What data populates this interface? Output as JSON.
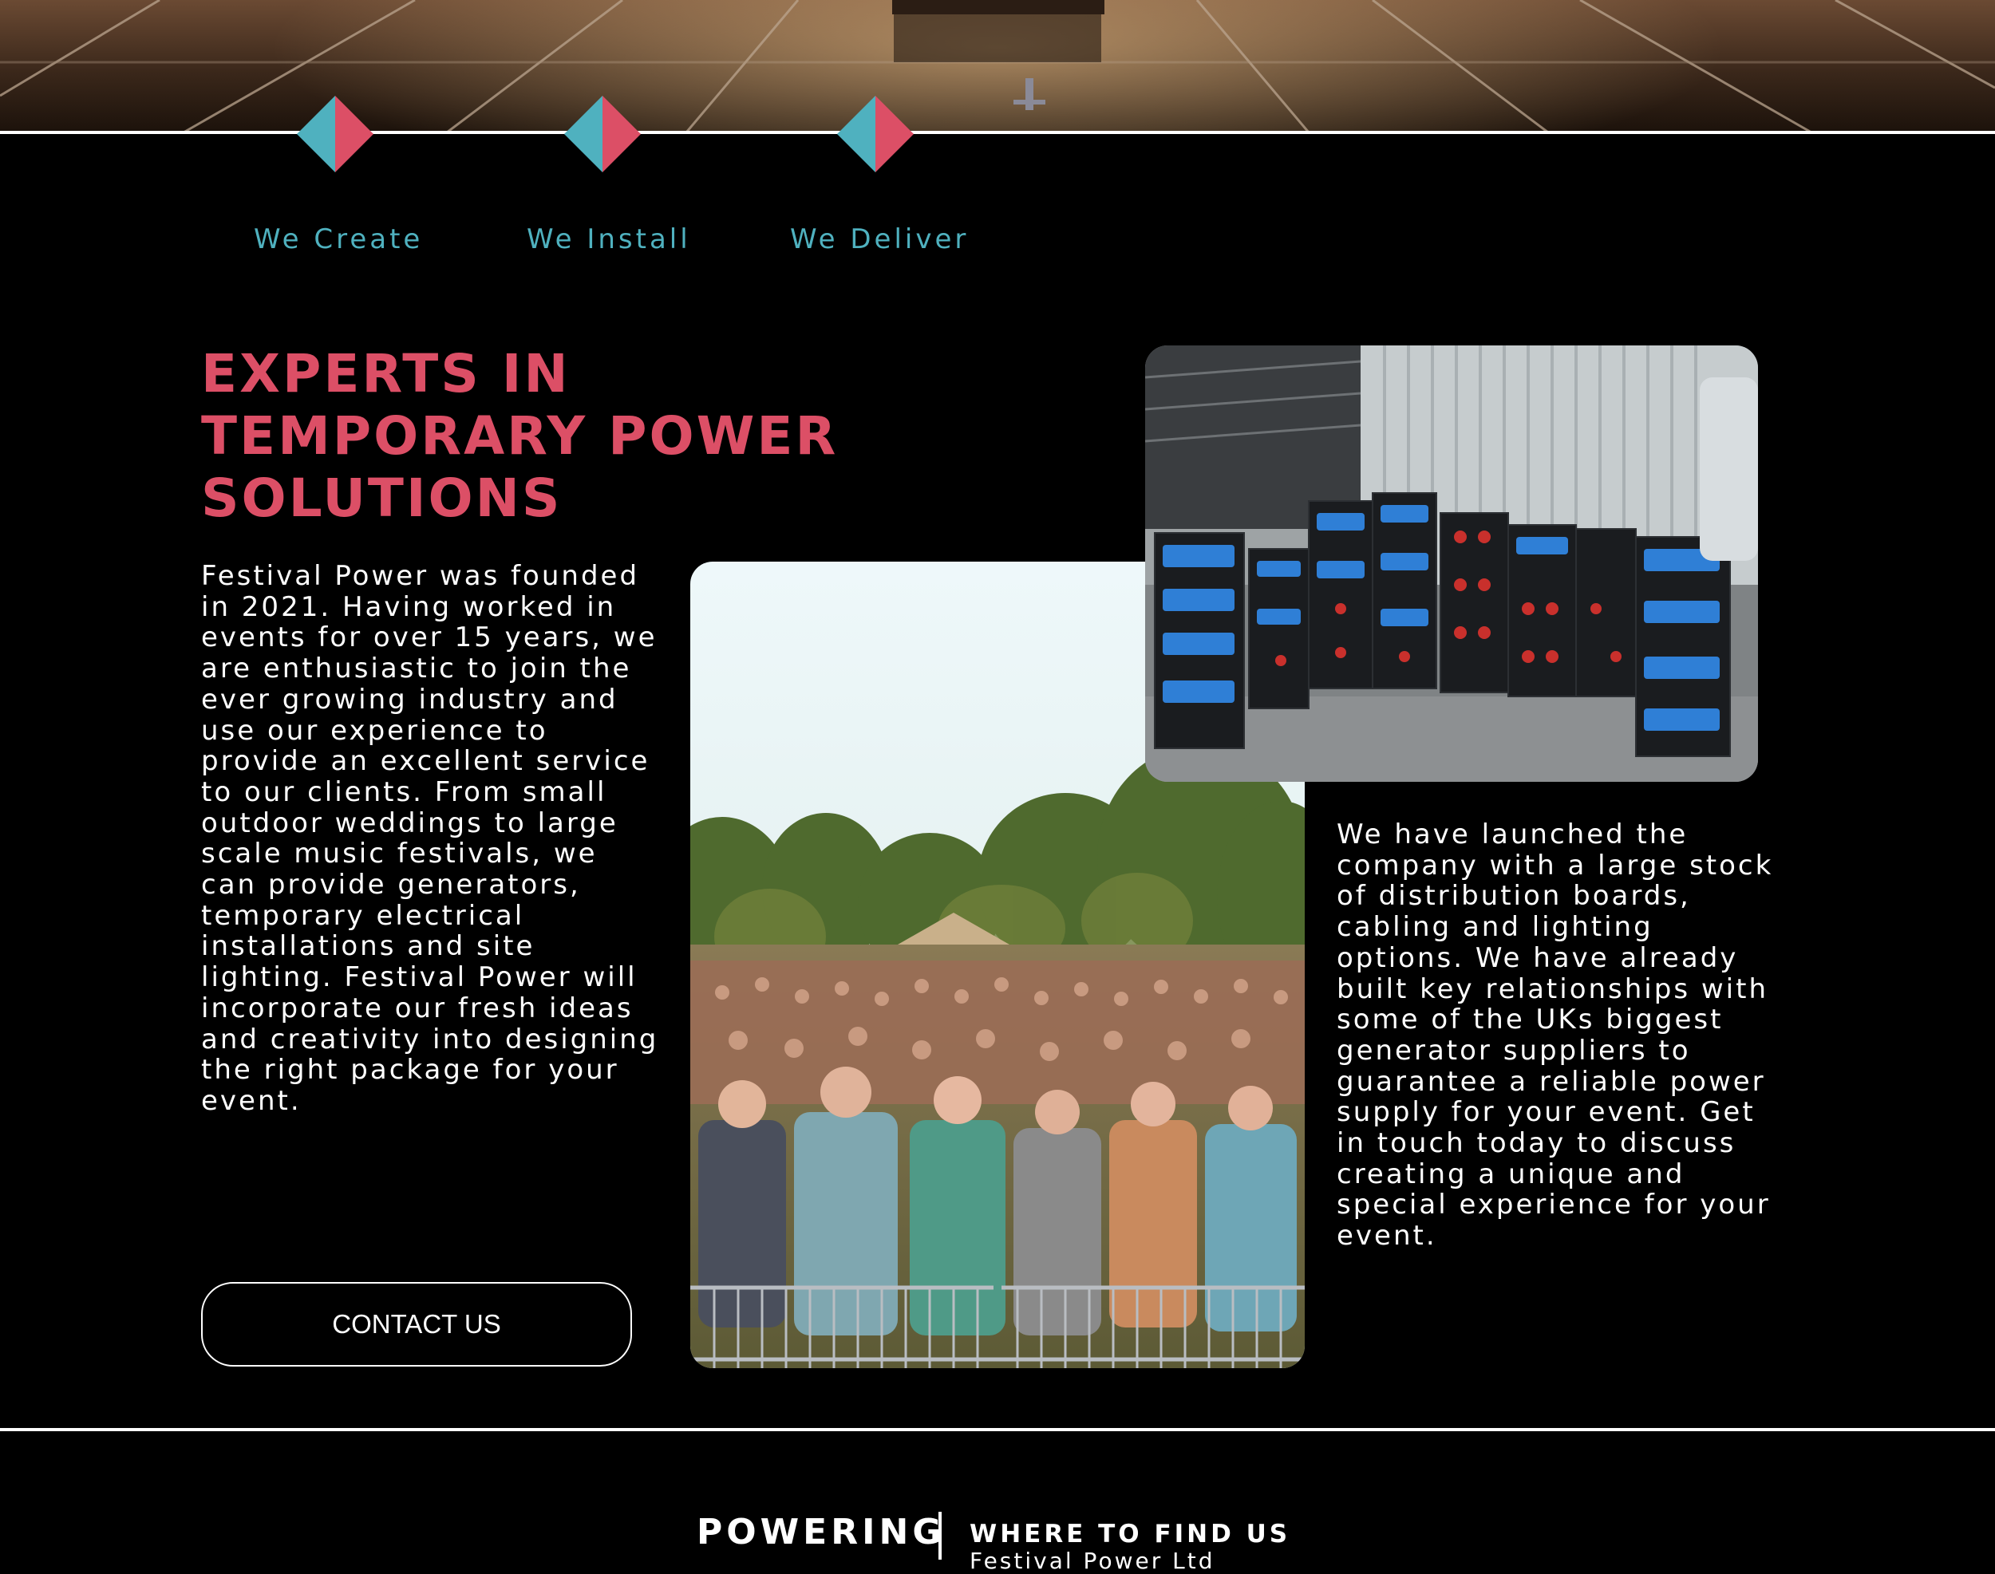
{
  "services": [
    {
      "label": "We Create"
    },
    {
      "label": "We Install"
    },
    {
      "label": "We Deliver"
    }
  ],
  "colors": {
    "accent_pink": "#dc4f66",
    "accent_teal": "#4fb1bf",
    "background": "#000000",
    "text": "#ffffff"
  },
  "about": {
    "headline": "EXPERTS IN TEMPORARY POWER SOLUTIONS",
    "intro": "Festival Power was founded in 2021. Having worked in events for over 15 years, we are enthusiastic to join the ever growing industry and use our experience to provide an excellent service to our clients. From small outdoor weddings to large scale music festivals, we can provide generators, temporary electrical installations and site lighting. Festival Power will incorporate our fresh ideas and creativity into designing the right package for your event.",
    "launch": "We have launched the company with a large stock of distribution boards, cabling and lighting options. We have already built key relationships with some of the UKs biggest generator suppliers to guarantee a reliable power supply for your event. Get in touch today to discuss creating a unique and special experience for your event.",
    "contact_label": "CONTACT US"
  },
  "footer": {
    "brand": "POWERING",
    "heading": "WHERE TO FIND US",
    "line": "Festival Power Ltd"
  }
}
